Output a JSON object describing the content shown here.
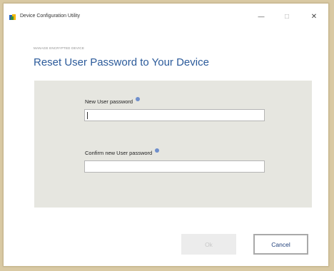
{
  "window": {
    "title": "Device Configuration Utility",
    "minimize_symbol": "—",
    "maximize_symbol": "□",
    "close_symbol": "✕",
    "icon": "app-icon"
  },
  "content": {
    "subtitle": "MANAGE ENCRYPTED DEVICE",
    "heading": "Reset User Password to Your Device"
  },
  "form": {
    "new_password_label": "New User password",
    "new_password_value": "",
    "confirm_password_label": "Confirm new User password",
    "confirm_password_value": "",
    "info_icon": "info-icon"
  },
  "buttons": {
    "ok_label": "Ok",
    "cancel_label": "Cancel"
  },
  "colors": {
    "heading": "#2b5a9a",
    "panel": "#e6e6e0",
    "info_dot": "#6f8fcc"
  }
}
